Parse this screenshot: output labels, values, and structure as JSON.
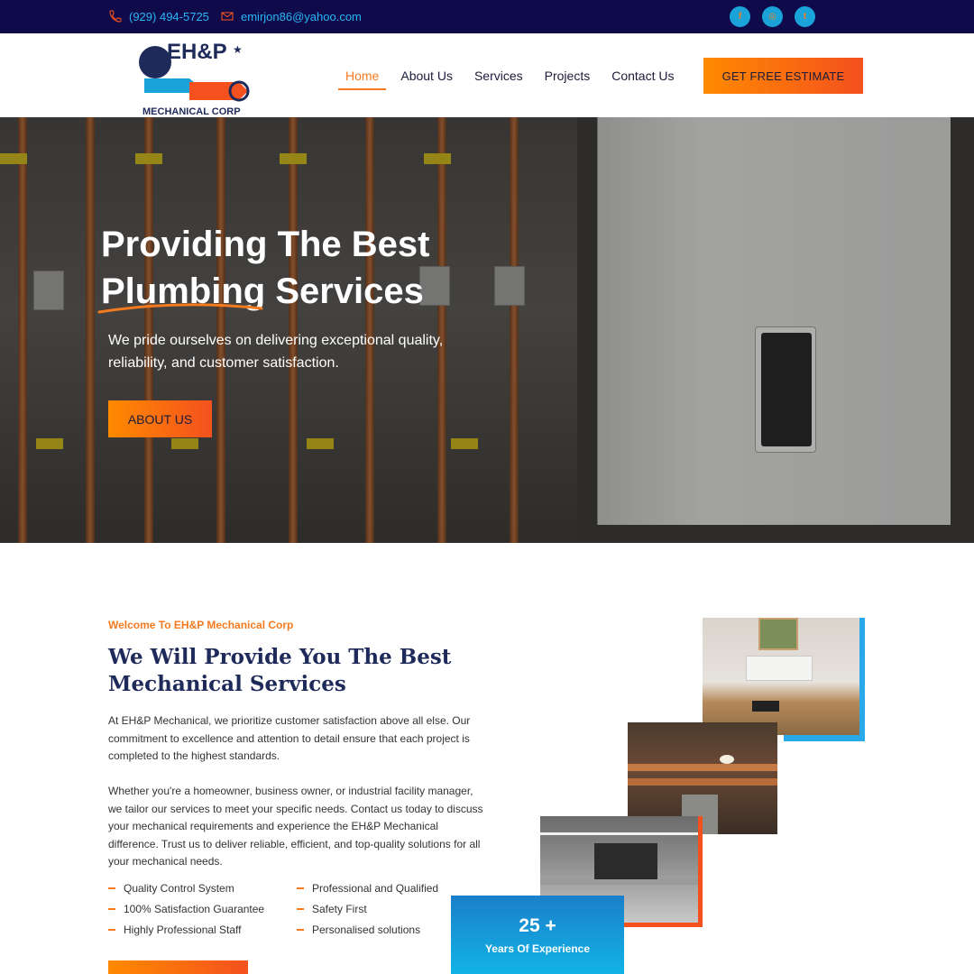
{
  "topbar": {
    "phone": "(929) 494-5725",
    "email": "emirjon86@yahoo.com",
    "social_icons": [
      "facebook-icon",
      "instagram-icon",
      "twitter-icon"
    ]
  },
  "header": {
    "logo": {
      "brand": "EH&P",
      "subtitle": "MECHANICAL CORP"
    },
    "nav": [
      "Home",
      "About Us",
      "Services",
      "Projects",
      "Contact Us"
    ],
    "active_nav": "Home",
    "cta": "GET FREE ESTIMATE"
  },
  "hero": {
    "title_line1": "Providing The Best",
    "title_line2": "Plumbing Services",
    "subtitle": "We pride ourselves on delivering exceptional quality, reliability, and customer satisfaction.",
    "button": "ABOUT US"
  },
  "about": {
    "eyebrow": "Welcome To EH&P Mechanical Corp",
    "title": "We Will Provide You The Best Mechanical Services",
    "paragraph1": "At EH&P Mechanical, we prioritize customer satisfaction above all else. Our commitment to excellence and attention to detail ensure that each project is completed to the highest standards.",
    "paragraph2": "Whether you're a homeowner, business owner, or industrial facility manager, we tailor our services to meet your specific needs. Contact us today to discuss your mechanical requirements and experience the EH&P Mechanical difference. Trust us to deliver reliable, efficient, and top-quality solutions for all your mechanical needs.",
    "features": [
      "Quality Control System",
      "Professional and Qualified",
      "100% Satisfaction Guarantee",
      "Safety First",
      "Highly Professional Staff",
      "Personalised solutions"
    ],
    "experience_number": "25 +",
    "experience_label": "Years Of Experience"
  },
  "colors": {
    "topbar_bg": "#0f0b4a",
    "accent_orange": "#f47a1f",
    "accent_blue": "#29a9ea",
    "heading_navy": "#1e2a5a"
  }
}
